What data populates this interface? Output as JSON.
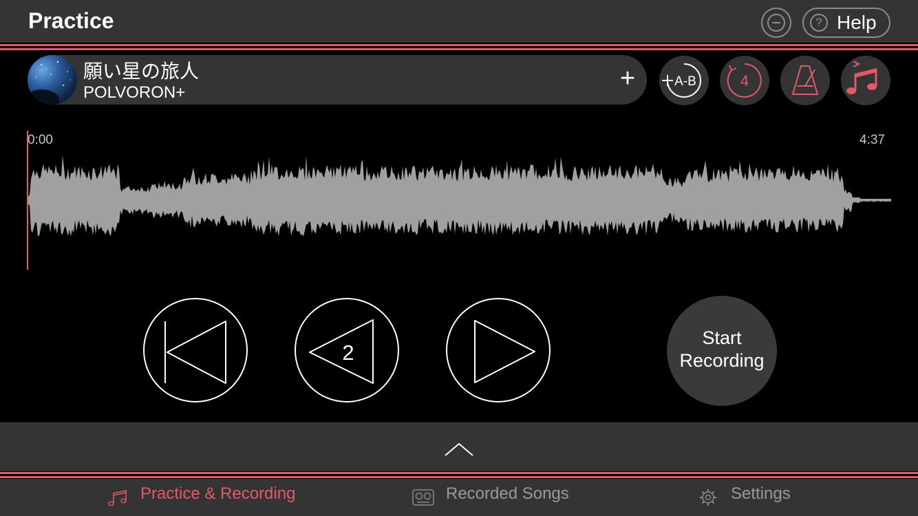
{
  "header": {
    "title": "Practice",
    "help_label": "Help",
    "help_glyph": "?"
  },
  "colors": {
    "accent": "#e05a6a",
    "bar_bg": "#343434",
    "waveform": "#a0a0a0"
  },
  "song": {
    "title": "願い星の旅人",
    "artist": "POLVORON+",
    "add_glyph": "+"
  },
  "tools": {
    "ab_label": "A-B",
    "count_in": "4",
    "metronome_icon": "metronome-icon",
    "pitch_icon": "music-note-icon"
  },
  "timeline": {
    "start": "0:00",
    "end": "4:37",
    "playhead_fraction": 0
  },
  "controls": {
    "rewind_seconds": "2",
    "record_line1": "Start",
    "record_line2": "Recording"
  },
  "tabs": [
    {
      "label": "Practice & Recording",
      "icon": "music-note-icon",
      "active": true
    },
    {
      "label": "Recorded Songs",
      "icon": "tape-icon",
      "active": false
    },
    {
      "label": "Settings",
      "icon": "gear-icon",
      "active": false
    }
  ]
}
